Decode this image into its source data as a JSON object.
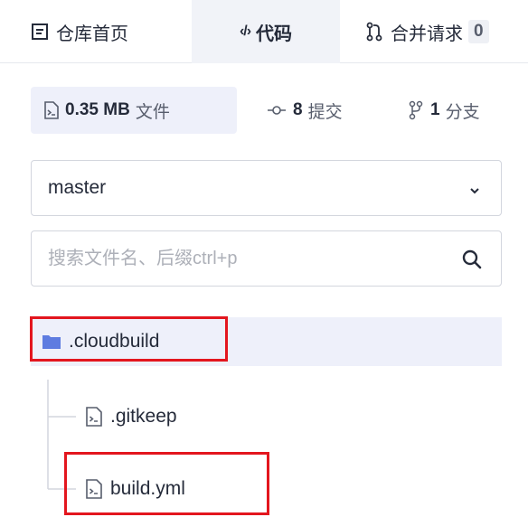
{
  "tabs": {
    "home": {
      "label": "仓库首页",
      "icon": "repo-home-icon"
    },
    "code": {
      "label": "代码",
      "icon": "code-icon",
      "active": true
    },
    "merge": {
      "label": "合并请求",
      "icon": "merge-request-icon",
      "count": "0"
    }
  },
  "stats": {
    "size": {
      "value": "0.35 MB",
      "label": "文件",
      "icon": "file-icon"
    },
    "commits": {
      "value": "8",
      "label": "提交",
      "icon": "commit-icon"
    },
    "branches": {
      "value": "1",
      "label": "分支",
      "icon": "branch-icon"
    }
  },
  "branch_select": {
    "value": "master",
    "icon": "chevron-down-icon"
  },
  "search": {
    "placeholder": "搜索文件名、后缀ctrl+p",
    "icon": "search-icon"
  },
  "tree": {
    "folder": {
      "name": ".cloudbuild",
      "icon": "folder-icon"
    },
    "files": [
      {
        "name": ".gitkeep",
        "icon": "file-icon"
      },
      {
        "name": "build.yml",
        "icon": "file-icon"
      }
    ]
  },
  "colors": {
    "highlight_border": "#e3161e",
    "folder": "#5e7ce0",
    "selected_bg": "#eef0fa",
    "text": "#252b3a"
  }
}
